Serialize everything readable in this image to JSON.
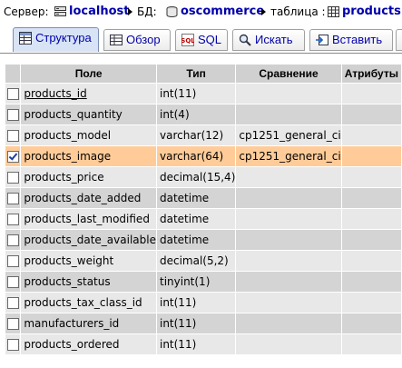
{
  "breadcrumb": {
    "server_label": "Сервер:",
    "server": "localhost",
    "db_label": "БД:",
    "db": "oscommerce",
    "table_label": "таблица :",
    "table": "products"
  },
  "tabs": [
    {
      "label": "Структура",
      "icon": "structure-icon"
    },
    {
      "label": "Обзор",
      "icon": "browse-icon"
    },
    {
      "label": "SQL",
      "icon": "sql-icon"
    },
    {
      "label": "Искать",
      "icon": "search-icon"
    },
    {
      "label": "Вставить",
      "icon": "insert-icon"
    }
  ],
  "columns": [
    "Поле",
    "Тип",
    "Сравнение",
    "Атрибуты"
  ],
  "rows": [
    {
      "field": "products_id",
      "type": "int(11)",
      "collation": "",
      "attributes": "",
      "checked": false,
      "primary": true
    },
    {
      "field": "products_quantity",
      "type": "int(4)",
      "collation": "",
      "attributes": "",
      "checked": false,
      "primary": false
    },
    {
      "field": "products_model",
      "type": "varchar(12)",
      "collation": "cp1251_general_ci",
      "attributes": "",
      "checked": false,
      "primary": false
    },
    {
      "field": "products_image",
      "type": "varchar(64)",
      "collation": "cp1251_general_ci",
      "attributes": "",
      "checked": true,
      "primary": false
    },
    {
      "field": "products_price",
      "type": "decimal(15,4)",
      "collation": "",
      "attributes": "",
      "checked": false,
      "primary": false
    },
    {
      "field": "products_date_added",
      "type": "datetime",
      "collation": "",
      "attributes": "",
      "checked": false,
      "primary": false
    },
    {
      "field": "products_last_modified",
      "type": "datetime",
      "collation": "",
      "attributes": "",
      "checked": false,
      "primary": false
    },
    {
      "field": "products_date_available",
      "type": "datetime",
      "collation": "",
      "attributes": "",
      "checked": false,
      "primary": false
    },
    {
      "field": "products_weight",
      "type": "decimal(5,2)",
      "collation": "",
      "attributes": "",
      "checked": false,
      "primary": false
    },
    {
      "field": "products_status",
      "type": "tinyint(1)",
      "collation": "",
      "attributes": "",
      "checked": false,
      "primary": false
    },
    {
      "field": "products_tax_class_id",
      "type": "int(11)",
      "collation": "",
      "attributes": "",
      "checked": false,
      "primary": false
    },
    {
      "field": "manufacturers_id",
      "type": "int(11)",
      "collation": "",
      "attributes": "",
      "checked": false,
      "primary": false
    },
    {
      "field": "products_ordered",
      "type": "int(11)",
      "collation": "",
      "attributes": "",
      "checked": false,
      "primary": false
    }
  ],
  "colors": {
    "link": "#0000aa",
    "marked_row": "#ffcc99",
    "header_bg": "#d0d0d0"
  }
}
